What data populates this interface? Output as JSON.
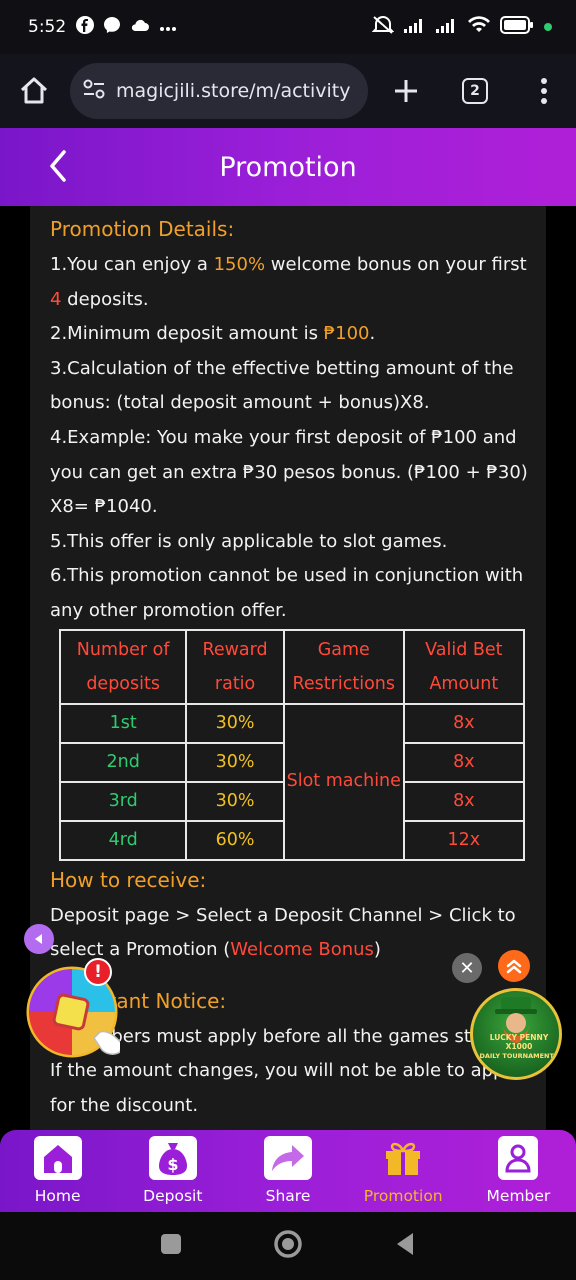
{
  "status_bar": {
    "time": "5:52",
    "left_icons": [
      "facebook-icon",
      "messenger-icon",
      "cloud-icon",
      "more-dots-icon"
    ],
    "right_icons": [
      "mute-icon",
      "signal-icon",
      "signal-icon",
      "wifi-icon",
      "battery-icon"
    ]
  },
  "browser": {
    "url": "magicjili.store/m/activity",
    "tab_count": "2"
  },
  "header": {
    "title": "Promotion"
  },
  "details": {
    "title": "Promotion Details:",
    "p1_pre": "1.You can enjoy a ",
    "p1_pct": "150%",
    "p1_mid": " welcome bonus on your first ",
    "p1_num": "4",
    "p1_post": " deposits.",
    "p2_pre": "2.Minimum deposit amount is ",
    "p2_amount": "₱100",
    "p2_post": ".",
    "p3": "3.Calculation of the effective betting amount of the bonus: (total deposit amount + bonus)X8.",
    "p4": "4.Example: You make your first deposit of ₱100 and you can get an extra ₱30 pesos bonus. (₱100 + ₱30) X8= ₱1040.",
    "p5": "5.This offer is only applicable to slot games.",
    "p6": "6.This promotion cannot be used in conjunction with any other promotion offer."
  },
  "table": {
    "headers": [
      "Number of deposits",
      "Reward ratio",
      "Game Restrictions",
      "Valid Bet Amount"
    ],
    "restriction": "Slot machine",
    "rows": [
      {
        "n": "1st",
        "ratio": "30%",
        "bet": "8x"
      },
      {
        "n": "2nd",
        "ratio": "30%",
        "bet": "8x"
      },
      {
        "n": "3rd",
        "ratio": "30%",
        "bet": "8x"
      },
      {
        "n": "4rd",
        "ratio": "60%",
        "bet": "12x"
      }
    ]
  },
  "receive": {
    "title": "How to receive:",
    "pre": "Deposit page > Select a Deposit Channel > Click to select a Promotion (",
    "bonus": "Welcome Bonus",
    "post": ")"
  },
  "notice": {
    "title": "Important Notice:",
    "p1": "1.Members must apply before all the games started. If the amount changes, you will not be able to apply for the discount."
  },
  "floating": {
    "badge": "!",
    "close": "✕",
    "promo_line1": "LUCKY PENNY X1000",
    "promo_line2": "DAILY TOURNAMENTS"
  },
  "nav": [
    {
      "label": "Home",
      "icon": "home-icon"
    },
    {
      "label": "Deposit",
      "icon": "money-bag-icon"
    },
    {
      "label": "Share",
      "icon": "share-icon"
    },
    {
      "label": "Promotion",
      "icon": "gift-icon"
    },
    {
      "label": "Member",
      "icon": "member-icon"
    }
  ],
  "colors": {
    "header_purple": "#9b1fd8",
    "accent_orange": "#f0a02a",
    "accent_red": "#ff4a3a",
    "green": "#2ecc71",
    "yellow": "#f0c020"
  }
}
